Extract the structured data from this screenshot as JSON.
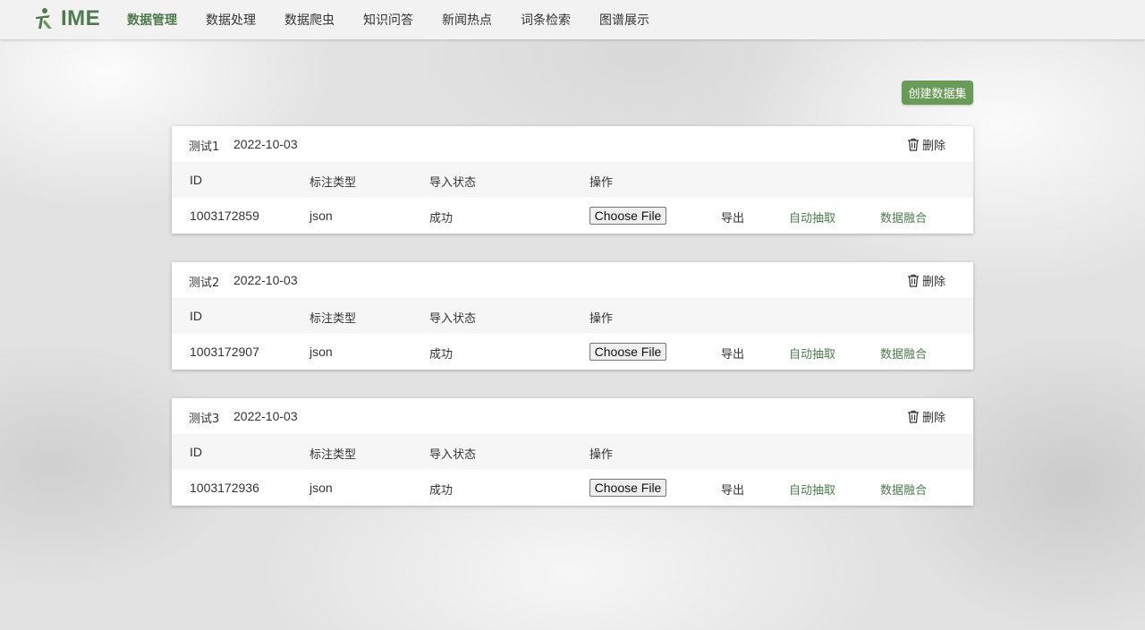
{
  "nav": {
    "logo_text": "IME",
    "items": [
      "数据管理",
      "数据处理",
      "数据爬虫",
      "知识问答",
      "新闻热点",
      "词条检索",
      "图谱展示"
    ],
    "active_index": 0
  },
  "actions": {
    "create_label": "创建数据集"
  },
  "columns": {
    "id": "ID",
    "type": "标注类型",
    "status": "导入状态",
    "op": "操作"
  },
  "row_actions": {
    "file_label": "Choose File",
    "export_label": "导出",
    "extract_label": "自动抽取",
    "merge_label": "数据融合",
    "delete_label": "删除"
  },
  "datasets": [
    {
      "name": "测试1",
      "date": "2022-10-03",
      "id": "1003172859",
      "type": "json",
      "status": "成功"
    },
    {
      "name": "测试2",
      "date": "2022-10-03",
      "id": "1003172907",
      "type": "json",
      "status": "成功"
    },
    {
      "name": "测试3",
      "date": "2022-10-03",
      "id": "1003172936",
      "type": "json",
      "status": "成功"
    }
  ],
  "colors": {
    "accent": "#4e7a4e",
    "button": "#6a9a58"
  }
}
